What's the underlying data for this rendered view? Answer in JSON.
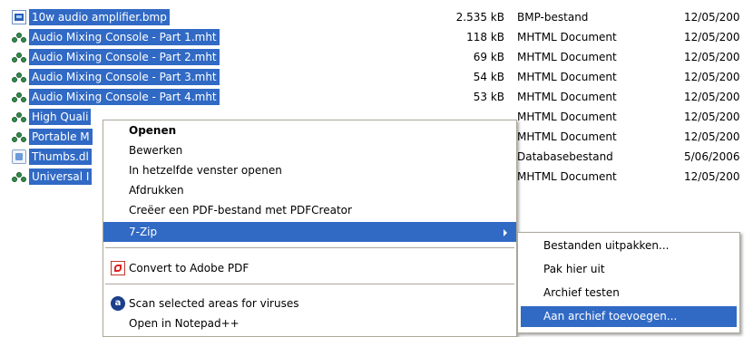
{
  "files": [
    {
      "name": "10w audio amplifier.bmp",
      "size": "2.535 kB",
      "type": "BMP-bestand",
      "date": "12/05/200",
      "icon": "bmp-file-icon"
    },
    {
      "name": "Audio Mixing Console - Part 1.mht",
      "size": "118 kB",
      "type": "MHTML Document",
      "date": "12/05/200",
      "icon": "mht-file-icon"
    },
    {
      "name": "Audio Mixing Console - Part 2.mht",
      "size": "69 kB",
      "type": "MHTML Document",
      "date": "12/05/200",
      "icon": "mht-file-icon"
    },
    {
      "name": "Audio Mixing Console - Part 3.mht",
      "size": "54 kB",
      "type": "MHTML Document",
      "date": "12/05/200",
      "icon": "mht-file-icon"
    },
    {
      "name": "Audio Mixing Console - Part 4.mht",
      "size": "53 kB",
      "type": "MHTML Document",
      "date": "12/05/200",
      "icon": "mht-file-icon"
    },
    {
      "name": "High Quali",
      "size": "",
      "type": "MHTML Document",
      "date": "12/05/200",
      "icon": "mht-file-icon"
    },
    {
      "name": "Portable M",
      "size": "",
      "type": "MHTML Document",
      "date": "12/05/200",
      "icon": "mht-file-icon"
    },
    {
      "name": "Thumbs.dl",
      "size": "",
      "type": "Databasebestand",
      "date": "5/06/2006",
      "icon": "database-file-icon"
    },
    {
      "name": "Universal I",
      "size": "",
      "type": "MHTML Document",
      "date": "12/05/200",
      "icon": "mht-file-icon"
    }
  ],
  "context_menu": {
    "open": "Openen",
    "edit": "Bewerken",
    "open_same_window": "In hetzelfde venster openen",
    "print": "Afdrukken",
    "pdfcreator": "Creëer een PDF-bestand met PDFCreator",
    "seven_zip": "7-Zip",
    "convert_pdf": "Convert to Adobe PDF",
    "scan": "Scan selected areas for viruses",
    "partial": "Open in Notepad++"
  },
  "submenu": {
    "extract_files": "Bestanden uitpakken...",
    "extract_here": "Pak hier uit",
    "test_archive": "Archief testen",
    "add_to_archive": "Aan archief toevoegen..."
  },
  "colors": {
    "selection": "#316ac5",
    "menu_border": "#aca899"
  }
}
